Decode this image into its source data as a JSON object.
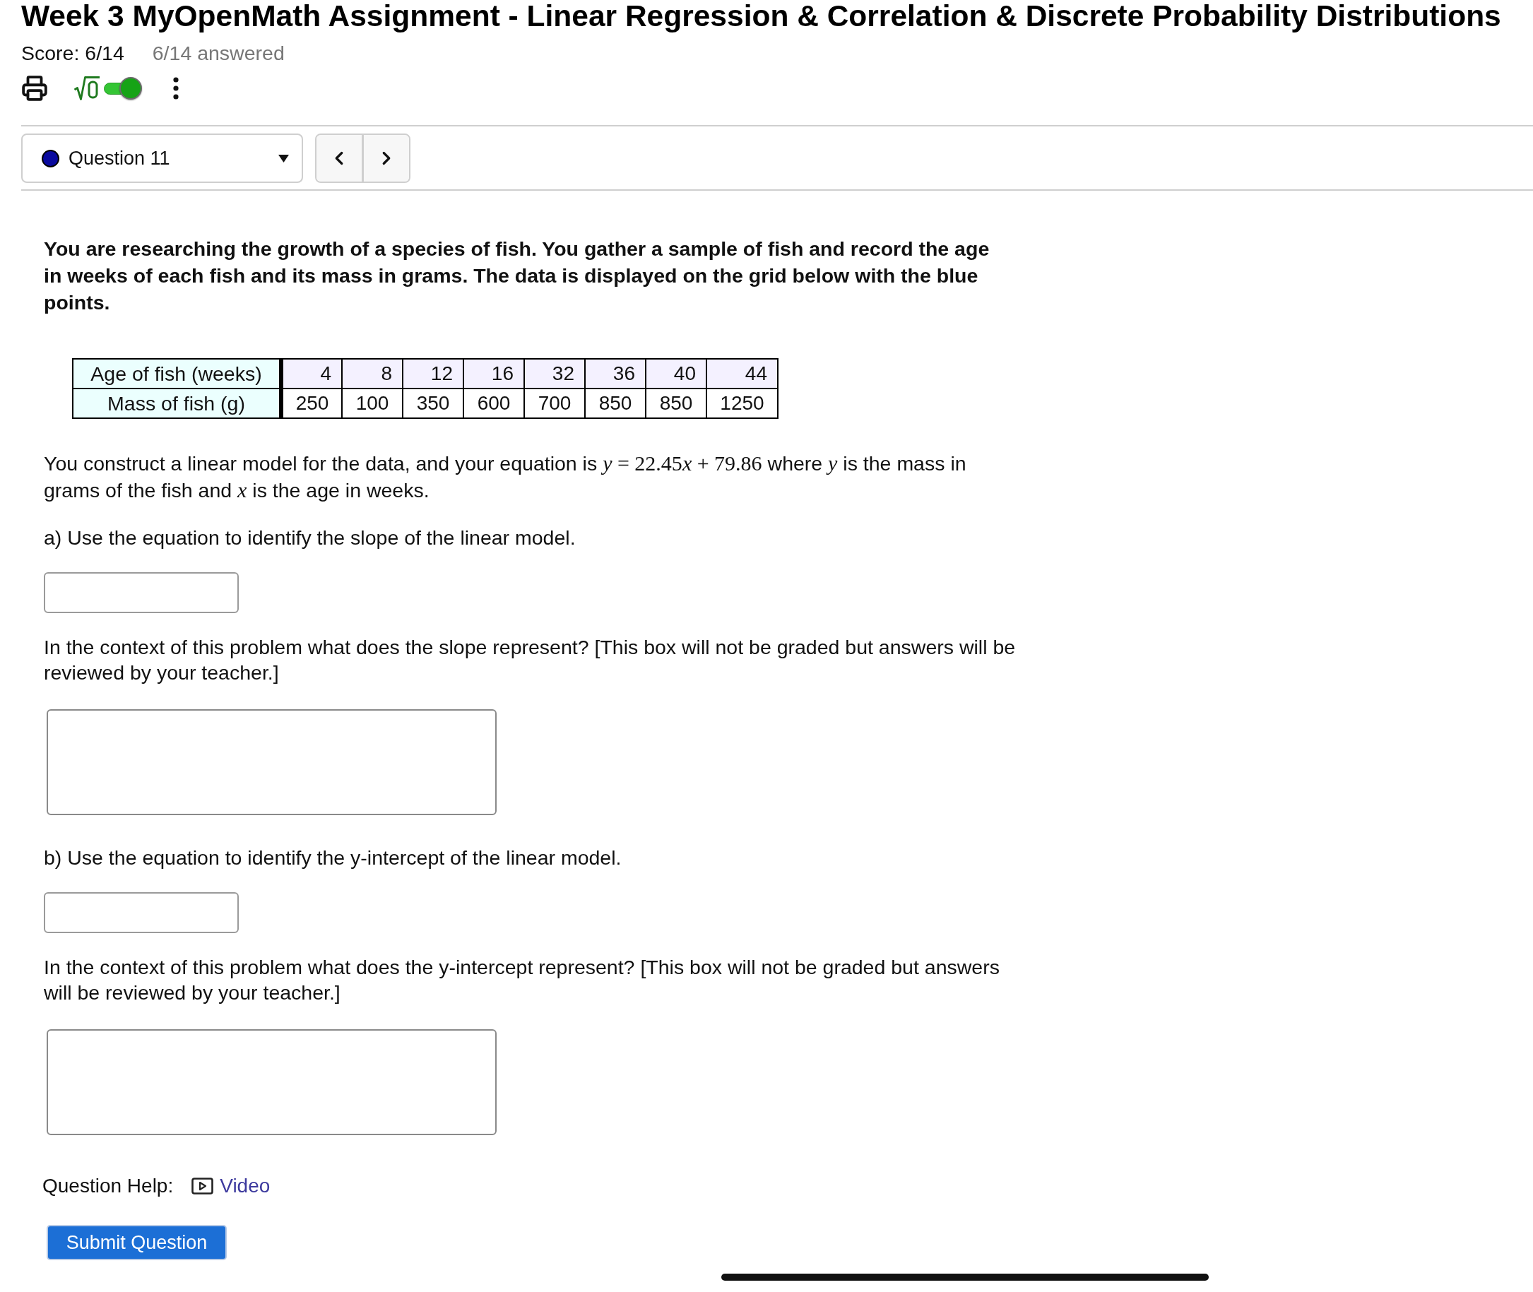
{
  "title": "Week 3 MyOpenMath Assignment - Linear Regression & Correlation & Discrete Probability Distributions",
  "score": {
    "label": "Score: 6/14",
    "answered": "6/14 answered"
  },
  "toolbar": {
    "math_entry": {
      "on": true
    }
  },
  "question_select": {
    "value": "Question 11",
    "color": "#0a0a9e"
  },
  "intro": "You are researching the growth of a species of fish. You gather a sample of fish and record the age in weeks of each fish and its mass in grams. The data is displayed on the grid below with the blue points.",
  "table": {
    "rows": [
      {
        "header": "Age of fish (weeks)",
        "cells": [
          "4",
          "8",
          "12",
          "16",
          "32",
          "36",
          "40",
          "44"
        ]
      },
      {
        "header": "Mass of fish (g)",
        "cells": [
          "250",
          "100",
          "350",
          "600",
          "700",
          "850",
          "850",
          "1250"
        ]
      }
    ]
  },
  "model_statement": {
    "segments": [
      {
        "kind": "text",
        "text": "You construct a linear model for the data, and your equation is "
      },
      {
        "kind": "math",
        "text": "*y* = 22.45"
      },
      {
        "kind": "math",
        "text": "*x*"
      },
      {
        "kind": "math",
        "text": " + 79.86"
      },
      {
        "kind": "text",
        "text": " where "
      },
      {
        "kind": "math",
        "text": "*y*"
      },
      {
        "kind": "text",
        "text": " is the mass in grams of the fish and "
      },
      {
        "kind": "math",
        "text": "*x*"
      },
      {
        "kind": "text",
        "text": " is the age in weeks."
      }
    ]
  },
  "parts": [
    {
      "kind": "prompt",
      "text": "a) Use the equation to identify the slope of the linear model."
    },
    {
      "kind": "short_answer"
    },
    {
      "kind": "prompt",
      "text": "In the context of this problem what does the slope represent? [This box will not be graded but answers will be reviewed by your teacher.]"
    },
    {
      "kind": "long_answer"
    },
    {
      "kind": "prompt",
      "text": "b) Use the equation to identify the y-intercept of the linear model."
    },
    {
      "kind": "short_answer"
    },
    {
      "kind": "prompt",
      "text": "In the context of this problem what does the y-intercept represent? [This box will not be graded but answers will be reviewed by your teacher.]"
    },
    {
      "kind": "long_answer"
    }
  ],
  "help": {
    "label": "Question Help:",
    "links": [
      {
        "label": "Video"
      }
    ]
  },
  "submit": "Submit Question"
}
